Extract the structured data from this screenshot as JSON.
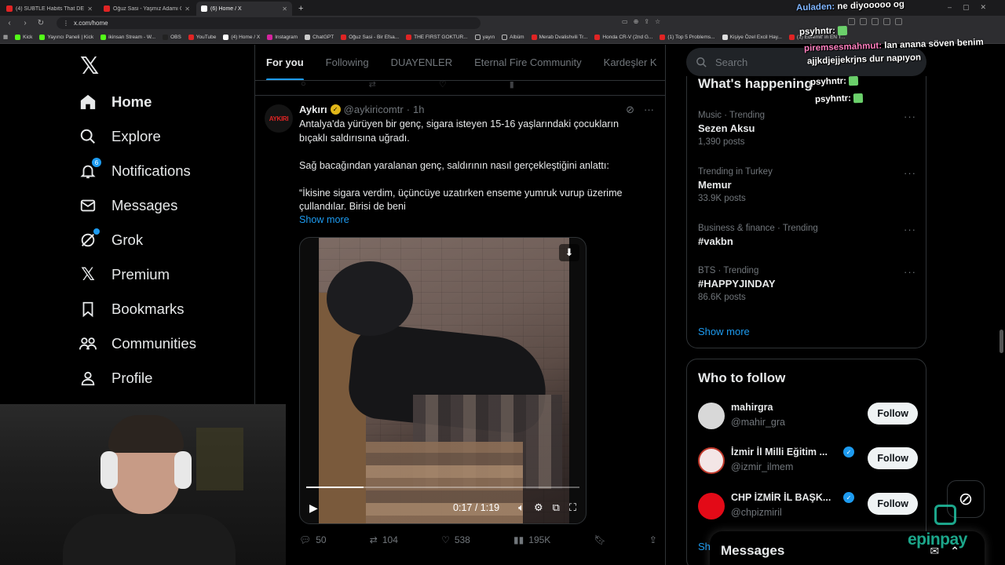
{
  "browser": {
    "tabs": [
      {
        "title": "(4) SUBTLE Habits That DESTROY Yo...",
        "active": false
      },
      {
        "title": "Oğuz Sasi - Yaşmız Adamı Olmak - ...",
        "active": false
      },
      {
        "title": "(6) Home / X",
        "active": true
      }
    ],
    "new_tab": "+",
    "url": "x.com/home",
    "bookmarks": [
      "Kick",
      "Yayıncı Paneli | Kick",
      "ikinsan Stream - W...",
      "OBS",
      "YouTube",
      "(4) Home / X",
      "Instagram",
      "ChatGPT",
      "Oğuz Sasi - Bir Efsa...",
      "THE FIRST GOKTUR...",
      "yayın",
      "Albüm",
      "Merab Dvalishvili Tr...",
      "Honda CR-V (2nd G...",
      "(1) Top 5 Problems...",
      "Kişiye Özel Excil Hay...",
      "(1) Edremit' in EN T..."
    ]
  },
  "nav": {
    "items": [
      {
        "label": "Home",
        "icon": "home-icon"
      },
      {
        "label": "Explore",
        "icon": "search-icon"
      },
      {
        "label": "Notifications",
        "icon": "bell-icon",
        "badge": "6"
      },
      {
        "label": "Messages",
        "icon": "envelope-icon"
      },
      {
        "label": "Grok",
        "icon": "grok-icon"
      },
      {
        "label": "Premium",
        "icon": "x-logo-icon"
      },
      {
        "label": "Bookmarks",
        "icon": "bookmark-icon"
      },
      {
        "label": "Communities",
        "icon": "people-icon"
      },
      {
        "label": "Profile",
        "icon": "person-icon"
      }
    ]
  },
  "feed": {
    "tabs": [
      "For you",
      "Following",
      "DUAYENLER",
      "Eternal Fire Community",
      "Kardeşler K"
    ],
    "tweet": {
      "avatar_text": "AYKIRI",
      "name": "Aykırı",
      "handle": "@aykiricomtr",
      "separator": "·",
      "time": "1h",
      "body": [
        "Antalya'da yürüyen bir genç, sigara isteyen 15-16 yaşlarındaki çocukların bıçaklı saldırısına uğradı.",
        "Sağ bacağından yaralanan genç, saldırının nasıl gerçekleştiğini anlattı:",
        "“İkisine sigara verdim, üçüncüye uzatırken enseme yumruk vurup üzerime çullandılar. Birisi de beni"
      ],
      "show_more": "Show more",
      "video": {
        "time": "0:17 / 1:19",
        "progress": 0.21
      },
      "replies": "50",
      "reposts": "104",
      "likes": "538",
      "views": "195K"
    }
  },
  "right": {
    "search_placeholder": "Search",
    "happening_title": "What's happening",
    "trends": [
      {
        "category": "Music · Trending",
        "name": "Sezen Aksu",
        "count": "1,390 posts"
      },
      {
        "category": "Trending in Turkey",
        "name": "Memur",
        "count": "33.9K posts"
      },
      {
        "category": "Business & finance · Trending",
        "name": "#vakbn",
        "count": ""
      },
      {
        "category": "BTS · Trending",
        "name": "#HAPPYJINDAY",
        "count": "86.6K posts"
      }
    ],
    "show_more": "Show more",
    "who_to_follow_title": "Who to follow",
    "follow": [
      {
        "name": "mahirgra",
        "handle": "@mahir_gra",
        "verified": false,
        "button": "Follow"
      },
      {
        "name": "İzmir İl Milli Eğitim ...",
        "handle": "@izmir_ilmem",
        "verified": true,
        "button": "Follow"
      },
      {
        "name": "CHP İZMİR İL BAŞK...",
        "handle": "@chpizmiril",
        "verified": true,
        "button": "Follow"
      }
    ],
    "show_more_short": "Sh"
  },
  "messages_drawer": {
    "title": "Messages"
  },
  "stream_overlay": {
    "chat": [
      {
        "user": "Auladen:",
        "text": "ne diyooooo og"
      },
      {
        "user": "psyhntr:",
        "text": ""
      },
      {
        "user": "piremsesmahmut:",
        "text": "lan anana söven benim"
      },
      {
        "user": "",
        "text": "ajjkdjejjekrjns dur napıyon"
      },
      {
        "user": "psyhntr:",
        "text": ""
      },
      {
        "user": "psyhntr:",
        "text": ""
      }
    ],
    "sponsor": "epinpay"
  }
}
